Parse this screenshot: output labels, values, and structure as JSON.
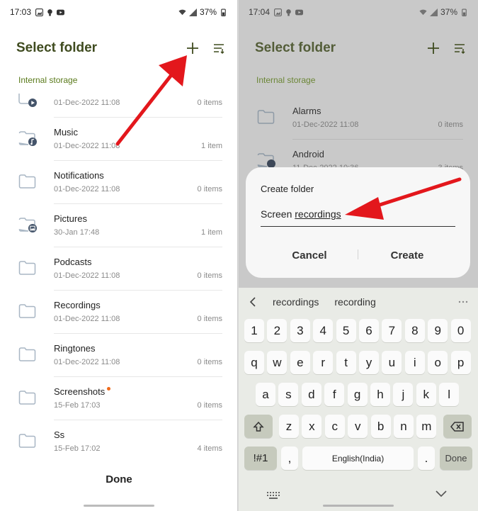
{
  "left": {
    "status": {
      "time": "17:03",
      "battery": "37%"
    },
    "title": "Select folder",
    "section": "Internal storage",
    "folders": [
      {
        "name": "",
        "date": "01-Dec-2022 11:08",
        "count": "0 items",
        "icon": "video-folder-icon"
      },
      {
        "name": "Music",
        "date": "01-Dec-2022 11:08",
        "count": "1 item",
        "icon": "music-folder-icon"
      },
      {
        "name": "Notifications",
        "date": "01-Dec-2022 11:08",
        "count": "0 items",
        "icon": "folder-icon"
      },
      {
        "name": "Pictures",
        "date": "30-Jan 17:48",
        "count": "1 item",
        "icon": "pictures-folder-icon"
      },
      {
        "name": "Podcasts",
        "date": "01-Dec-2022 11:08",
        "count": "0 items",
        "icon": "folder-icon"
      },
      {
        "name": "Recordings",
        "date": "01-Dec-2022 11:08",
        "count": "0 items",
        "icon": "folder-icon"
      },
      {
        "name": "Ringtones",
        "date": "01-Dec-2022 11:08",
        "count": "0 items",
        "icon": "folder-icon"
      },
      {
        "name": "Screenshots",
        "date": "15-Feb 17:03",
        "count": "0 items",
        "icon": "folder-icon"
      },
      {
        "name": "Ss",
        "date": "15-Feb 17:02",
        "count": "4 items",
        "icon": "folder-icon"
      }
    ],
    "done_label": "Done"
  },
  "right": {
    "status": {
      "time": "17:04",
      "battery": "37%"
    },
    "title": "Select folder",
    "section": "Internal storage",
    "folders": [
      {
        "name": "Alarms",
        "date": "01-Dec-2022 11:08",
        "count": "0 items"
      },
      {
        "name": "Android",
        "date": "11-Dec-2022 10:36",
        "count": "3 items"
      }
    ],
    "dialog": {
      "title": "Create folder",
      "input_prefix": "Screen ",
      "input_suffix": "recordings",
      "cancel_label": "Cancel",
      "create_label": "Create"
    },
    "keyboard": {
      "suggestions": [
        "recordings",
        "recording"
      ],
      "row_numbers": [
        "1",
        "2",
        "3",
        "4",
        "5",
        "6",
        "7",
        "8",
        "9",
        "0"
      ],
      "row_q": [
        "q",
        "w",
        "e",
        "r",
        "t",
        "y",
        "u",
        "i",
        "o",
        "p"
      ],
      "row_a": [
        "a",
        "s",
        "d",
        "f",
        "g",
        "h",
        "j",
        "k",
        "l"
      ],
      "row_z": [
        "z",
        "x",
        "c",
        "v",
        "b",
        "n",
        "m"
      ],
      "sym_label": "!#1",
      "comma": ",",
      "space_label": "English(India)",
      "period": ".",
      "done_label": "Done"
    }
  },
  "colors": {
    "accent_text": "#5a7a1b",
    "title": "#3f4b1f",
    "arrow": "#e3171c",
    "folder_stroke": "#a8b6c4"
  }
}
